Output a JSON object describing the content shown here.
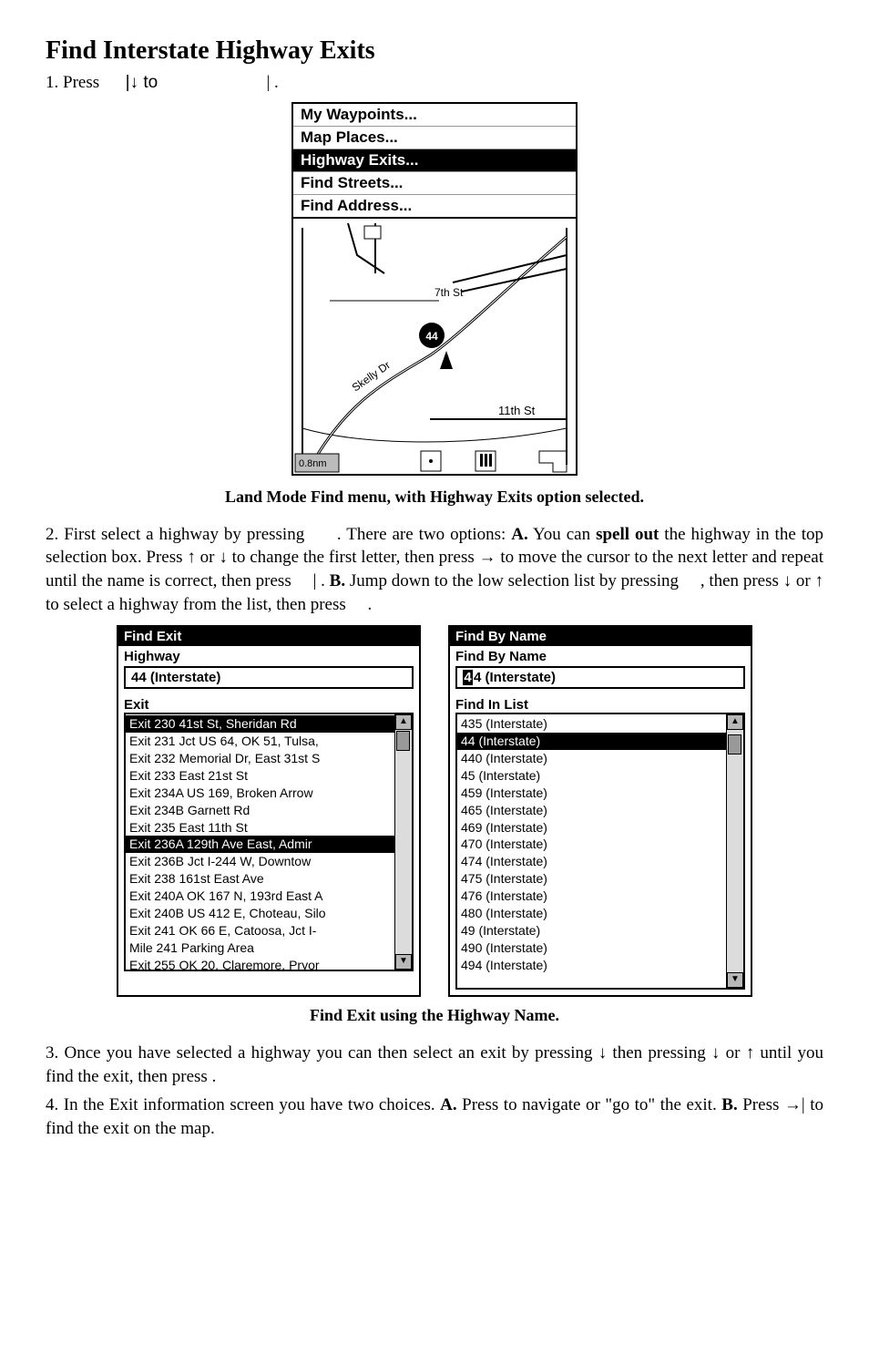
{
  "title": "Find Interstate Highway Exits",
  "step1_a": "1. Press ",
  "step1_b": "|↓ to ",
  "step1_c": "| .",
  "shot1_menu": [
    {
      "label": "My Waypoints...",
      "sel": false
    },
    {
      "label": "Map Places...",
      "sel": false
    },
    {
      "label": "Highway Exits...",
      "sel": true
    },
    {
      "label": "Find Streets...",
      "sel": false
    },
    {
      "label": "Find Address...",
      "sel": false
    }
  ],
  "map_labels": {
    "seventh": "7th St",
    "eleventh": "11th St",
    "skelly": "Skelly Dr",
    "route": "44",
    "scale": "0.8nm"
  },
  "caption1": "Land Mode Find menu, with Highway Exits option selected.",
  "para2": {
    "a": "2. First select a highway by pressing ",
    "b": ". There are two options: ",
    "bold_A": "A.",
    "c": " You can ",
    "bold_spell": "spell out",
    "d": " the highway in the top selection box. Press ↑ or ↓ to change the first letter, then press → to move the cursor to the next letter and repeat until the name is correct, then press ",
    "e": "| . ",
    "bold_B": "B.",
    "f": " Jump down to the low selection list by pressing ",
    "g": ", then press ↓ or ↑ to select a highway from the list, then press ",
    "h": "."
  },
  "find_exit_win": {
    "title": "Find Exit",
    "hwy_lbl": "Highway",
    "hwy_val": "44 (Interstate)",
    "exit_lbl": "Exit",
    "items": [
      {
        "t": "Exit 230 41st St, Sheridan Rd",
        "sel": true
      },
      {
        "t": "Exit 231 Jct US 64, OK 51, Tulsa,",
        "sel": false
      },
      {
        "t": "Exit 232 Memorial Dr, East 31st S",
        "sel": false
      },
      {
        "t": "Exit 233 East 21st St",
        "sel": false
      },
      {
        "t": "Exit 234A US 169, Broken Arrow",
        "sel": false
      },
      {
        "t": "Exit 234B Garnett Rd",
        "sel": false
      },
      {
        "t": "Exit 235 East 11th St",
        "sel": false
      },
      {
        "t": "Exit 236A 129th Ave East, Admir",
        "sel": true
      },
      {
        "t": "Exit 236B Jct I-244 W, Downtow",
        "sel": false
      },
      {
        "t": "Exit 238 161st East Ave",
        "sel": false
      },
      {
        "t": "Exit 240A OK 167 N, 193rd East A",
        "sel": false
      },
      {
        "t": "Exit 240B US 412 E, Choteau, Silo",
        "sel": false
      },
      {
        "t": "Exit 241 OK 66 E, Catoosa, Jct I-",
        "sel": false
      },
      {
        "t": "Mile 241 Parking Area",
        "sel": false
      },
      {
        "t": "Exit 255 OK 20, Claremore, Pryor",
        "sel": false
      }
    ]
  },
  "find_by_name_win": {
    "title": "Find By Name",
    "name_lbl": "Find By Name",
    "name_cursor": "4",
    "name_rest": "4 (Interstate)",
    "list_lbl": "Find In List",
    "items": [
      {
        "t": "435 (Interstate)",
        "sel": false
      },
      {
        "t": "44 (Interstate)",
        "sel": true
      },
      {
        "t": "440 (Interstate)",
        "sel": false
      },
      {
        "t": "45 (Interstate)",
        "sel": false
      },
      {
        "t": "459 (Interstate)",
        "sel": false
      },
      {
        "t": "465 (Interstate)",
        "sel": false
      },
      {
        "t": "469 (Interstate)",
        "sel": false
      },
      {
        "t": "470 (Interstate)",
        "sel": false
      },
      {
        "t": "474 (Interstate)",
        "sel": false
      },
      {
        "t": "475 (Interstate)",
        "sel": false
      },
      {
        "t": "476 (Interstate)",
        "sel": false
      },
      {
        "t": "480 (Interstate)",
        "sel": false
      },
      {
        "t": "49 (Interstate)",
        "sel": false
      },
      {
        "t": "490 (Interstate)",
        "sel": false
      },
      {
        "t": "494 (Interstate)",
        "sel": false
      }
    ]
  },
  "caption2": "Find Exit using the Highway Name.",
  "para3": "3. Once you have selected a highway you can then select an exit by pressing ↓ then pressing ↓ or ↑ until you find the exit, then press .",
  "para4": {
    "a": "4. In the Exit information screen you have two choices. ",
    "bold_A": "A.",
    "b": " Press  to navigate or \"go to\" the exit. ",
    "bold_B": "B.",
    "c": " Press →|  to find the exit on the map."
  }
}
